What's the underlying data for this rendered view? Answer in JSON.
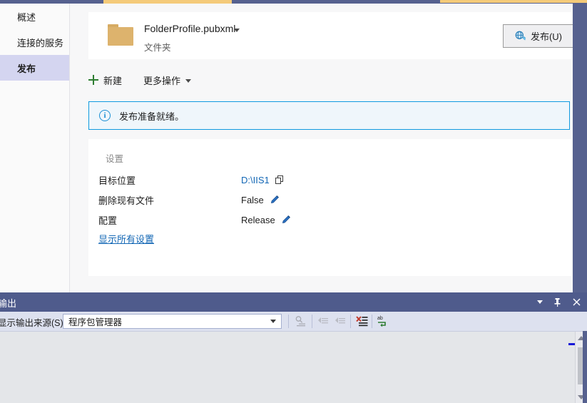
{
  "sidebar": {
    "items": [
      {
        "label": "概述",
        "name": "overview",
        "selected": false
      },
      {
        "label": "连接的服务",
        "name": "connected-services",
        "selected": false
      },
      {
        "label": "发布",
        "name": "publish",
        "selected": true
      }
    ]
  },
  "header": {
    "profile_name": "FolderProfile.pubxml",
    "profile_kind": "文件夹",
    "folder_icon": "folder-icon",
    "caret_icon": "chevron-down-icon",
    "publish_button": {
      "label": "发布(U)",
      "icon": "publish-globe-icon"
    }
  },
  "toolbar": {
    "new_label": "新建",
    "new_icon": "plus-icon",
    "more_label": "更多操作",
    "more_caret_icon": "chevron-down-icon"
  },
  "info_bar": {
    "icon": "info-circle-icon",
    "message": "发布准备就绪。"
  },
  "settings": {
    "title": "设置",
    "rows": [
      {
        "label": "目标位置",
        "value": "D:\\IIS1",
        "value_is_link": true,
        "action_icon": "copy-icon"
      },
      {
        "label": "删除现有文件",
        "value": "False",
        "value_is_link": false,
        "action_icon": "pencil-edit-icon"
      },
      {
        "label": "配置",
        "value": "Release",
        "value_is_link": false,
        "action_icon": "pencil-edit-icon"
      }
    ],
    "show_all_link": "显示所有设置"
  },
  "output_panel": {
    "title": "输出",
    "header_icons": [
      "chevron-down-icon",
      "pin-icon",
      "close-icon"
    ],
    "source_label": "显示输出来源(S):",
    "source_value": "程序包管理器",
    "source_caret_icon": "chevron-down-icon",
    "toolbar_icons": [
      "find-message-icon",
      "previous-message-icon",
      "next-message-icon",
      "clear-all-icon",
      "toggle-word-wrap-icon"
    ],
    "body_text": "",
    "scrollbar": {
      "up_icon": "scroll-up-arrow-icon",
      "down_icon": "scroll-down-arrow-icon",
      "thumb": "scrollbar-thumb"
    }
  },
  "colors": {
    "accent_blue": "#1367b5",
    "info_border": "#0f9ae0",
    "info_fill": "#eff6fb",
    "selected_nav": "#d4d5f0",
    "panel_header": "#4f5b8c",
    "tab_active": "#f4ca79",
    "folder": "#ddb36d",
    "plus_green": "#2e7d32",
    "clear_red": "#c0392b"
  }
}
